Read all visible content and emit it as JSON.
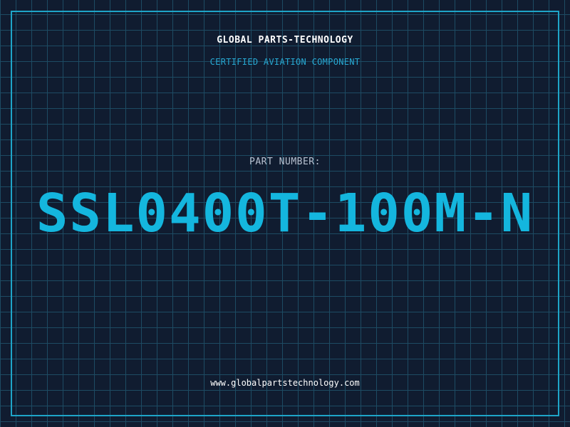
{
  "header": {
    "company_name": "GLOBAL PARTS-TECHNOLOGY",
    "tagline": "CERTIFIED AVIATION COMPONENT"
  },
  "part": {
    "label": "PART NUMBER:",
    "number": "SSL0400T-100M-N"
  },
  "footer": {
    "website": "www.globalpartstechnology.com"
  },
  "colors": {
    "background": "#101c30",
    "grid": "#1d4b63",
    "accent": "#14b6de",
    "border": "#1ea5c8",
    "label": "#b8c2d1",
    "text": "#ffffff"
  }
}
